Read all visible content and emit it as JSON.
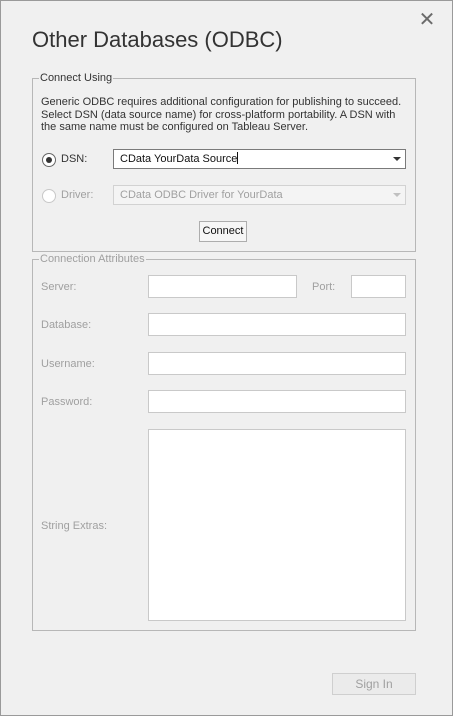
{
  "dialog": {
    "title": "Other Databases (ODBC)",
    "close_glyph": "✕"
  },
  "connect_using": {
    "legend": "Connect Using",
    "description": "Generic ODBC requires additional configuration for publishing to succeed. Select DSN (data source name) for cross-platform portability. A DSN with the same name must be configured on Tableau Server.",
    "dsn_label": "DSN:",
    "dsn_value": "CData YourData Source",
    "driver_label": "Driver:",
    "driver_value": "CData ODBC Driver for YourData",
    "selected_option": "DSN",
    "connect_label": "Connect"
  },
  "connection_attributes": {
    "legend": "Connection Attributes",
    "server_label": "Server:",
    "port_label": "Port:",
    "database_label": "Database:",
    "username_label": "Username:",
    "password_label": "Password:",
    "string_extras_label": "String Extras:",
    "server_value": "",
    "port_value": "",
    "database_value": "",
    "username_value": "",
    "password_value": "",
    "string_extras_value": ""
  },
  "footer": {
    "sign_in_label": "Sign In"
  },
  "colors": {
    "background": "#f0f0f0",
    "disabled_text": "#a0a0a0",
    "text": "#333333"
  }
}
